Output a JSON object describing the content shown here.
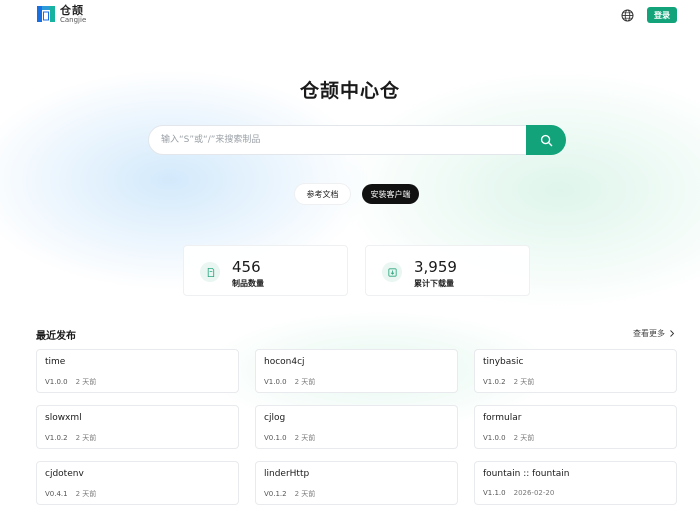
{
  "header": {
    "logo_cn": "仓颉",
    "logo_en": "Cangjie",
    "login_label": "登录"
  },
  "hero": {
    "title": "仓颉中心仓",
    "search_placeholder": "输入“S”或“/”来搜索制品",
    "search_value": ""
  },
  "actions": {
    "docs_label": "参考文档",
    "install_label": "安装客户端"
  },
  "stats": [
    {
      "value": "456",
      "label": "制品数量",
      "icon": "package-icon"
    },
    {
      "value": "3,959",
      "label": "累计下载量",
      "icon": "download-icon"
    }
  ],
  "recent": {
    "title": "最近发布",
    "see_more": "查看更多",
    "cards": [
      {
        "name": "time",
        "version": "V1.0.0",
        "time": "2 天前"
      },
      {
        "name": "hocon4cj",
        "version": "V1.0.0",
        "time": "2 天前"
      },
      {
        "name": "tinybasic",
        "version": "V1.0.2",
        "time": "2 天前"
      },
      {
        "name": "slowxml",
        "version": "V1.0.2",
        "time": "2 天前"
      },
      {
        "name": "cjlog",
        "version": "V0.1.0",
        "time": "2 天前"
      },
      {
        "name": "formular",
        "version": "V1.0.0",
        "time": "2 天前"
      },
      {
        "name": "cjdotenv",
        "version": "V0.4.1",
        "time": "2 天前"
      },
      {
        "name": "linderHttp",
        "version": "V0.1.2",
        "time": "2 天前"
      },
      {
        "name": "fountain :: fountain",
        "version": "V1.1.0",
        "time": "2026-02-20"
      }
    ]
  },
  "colors": {
    "accent": "#12a37b",
    "dark_button": "#111111"
  }
}
